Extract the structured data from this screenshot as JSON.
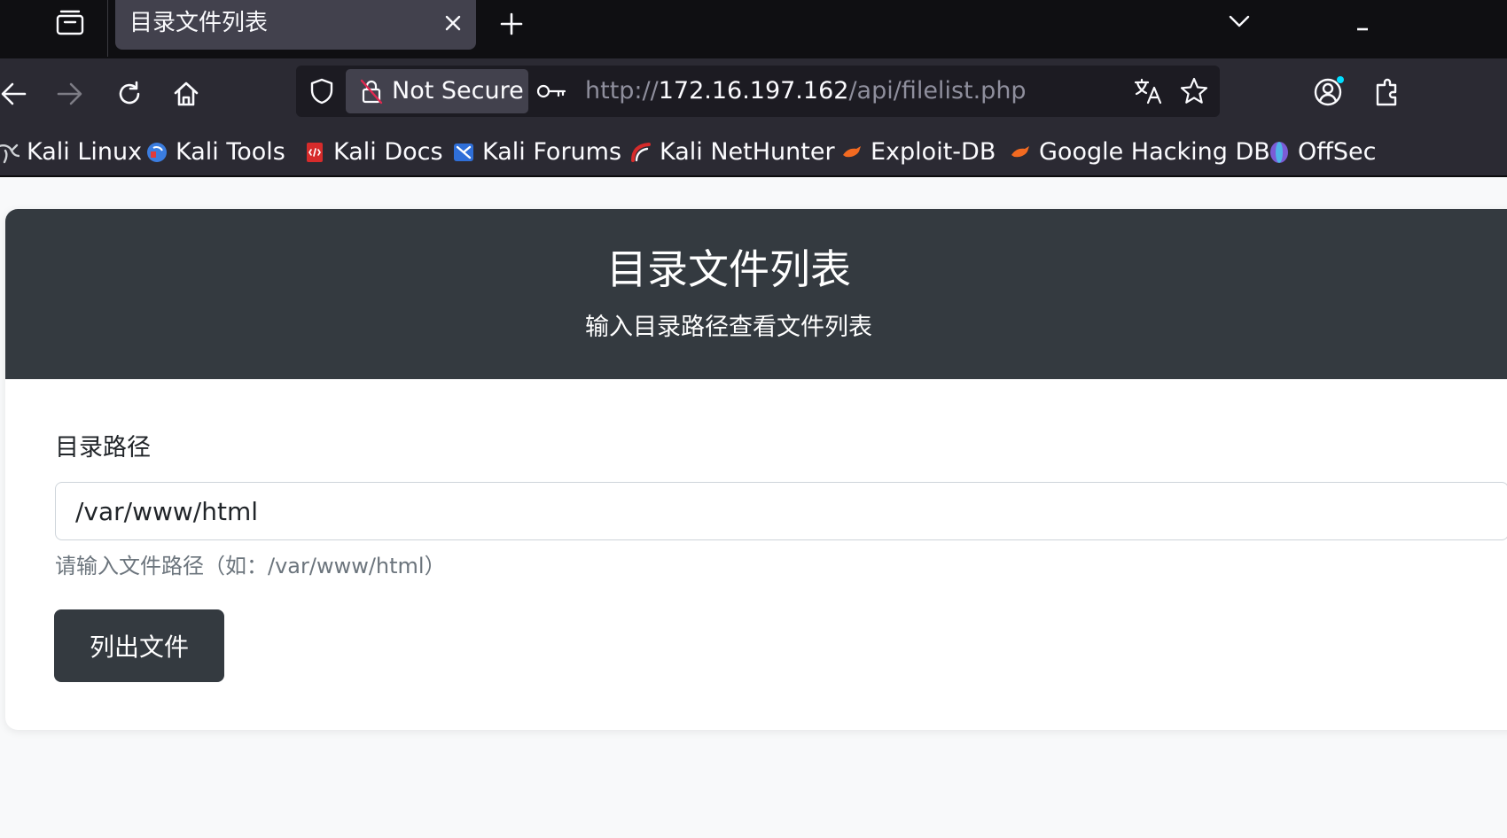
{
  "browser": {
    "tab": {
      "title": "目录文件列表"
    },
    "security_label": "Not Secure",
    "url": {
      "scheme": "http://",
      "host": "172.16.197.162",
      "path": "/api/filelist.php"
    },
    "bookmarks": [
      {
        "label": "Kali Linux",
        "icon": "kali-dragon-icon",
        "color": "#cfd2d6"
      },
      {
        "label": "Kali Tools",
        "icon": "kali-tools-icon",
        "color": "#3b7de0"
      },
      {
        "label": "Kali Docs",
        "icon": "kali-docs-icon",
        "color": "#d62b2b"
      },
      {
        "label": "Kali Forums",
        "icon": "kali-forums-icon",
        "color": "#2f6fd8"
      },
      {
        "label": "Kali NetHunter",
        "icon": "kali-nethunter-icon",
        "color": "#d62b2b"
      },
      {
        "label": "Exploit-DB",
        "icon": "exploit-db-icon",
        "color": "#f26a21"
      },
      {
        "label": "Google Hacking DB",
        "icon": "ghdb-icon",
        "color": "#f26a21"
      },
      {
        "label": "OffSec",
        "icon": "offsec-icon",
        "color": "#7b5cd6"
      }
    ]
  },
  "page": {
    "title": "目录文件列表",
    "subtitle": "输入目录路径查看文件列表",
    "form": {
      "label": "目录路径",
      "path_value": "/var/www/html",
      "help": "请输入文件路径（如：/var/www/html）",
      "submit_label": "列出文件"
    }
  },
  "colors": {
    "header_bg": "#343a40",
    "button_bg": "#343a40",
    "page_bg": "#f8f9fa",
    "browser_chrome": "#2b2a33"
  }
}
